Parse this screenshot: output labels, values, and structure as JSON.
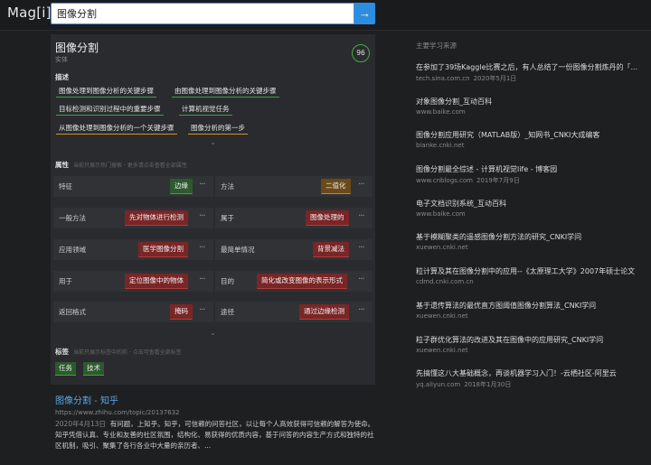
{
  "app": {
    "logo": "Mag[i]"
  },
  "search": {
    "value": "图像分割",
    "button_icon": "→"
  },
  "entity": {
    "title": "图像分割",
    "type": "实体",
    "score": "96"
  },
  "description": {
    "label": "描述",
    "tags": [
      {
        "text": "图像处理到图像分析的关键步骤",
        "color": "green"
      },
      {
        "text": "由图像处理到图像分析的关键步骤",
        "color": "green"
      },
      {
        "text": "目标检测和识别过程中的重要步骤",
        "color": "green"
      },
      {
        "text": "计算机视觉任务",
        "color": "green"
      },
      {
        "text": "从图像处理到图像分析的一个关键步骤",
        "color": "orange"
      },
      {
        "text": "图像分析的第一步",
        "color": "orange"
      }
    ],
    "expand_icon": "⌄"
  },
  "properties": {
    "label": "属性",
    "hint": "当前只展示热门搜索 · 更多请点击查看全部属性",
    "more_icon": "···",
    "rows": [
      {
        "key": "特征",
        "value": "边缘",
        "color": "green"
      },
      {
        "key": "方法",
        "value": "二值化",
        "color": "orange"
      },
      {
        "key": "一般方法",
        "value": "先对物体进行检测",
        "color": "red"
      },
      {
        "key": "属于",
        "value": "图像处理的",
        "color": "red"
      },
      {
        "key": "应用领域",
        "value": "医学图像分割",
        "color": "red"
      },
      {
        "key": "最简单情况",
        "value": "背景减法",
        "color": "red"
      },
      {
        "key": "用于",
        "value": "定位图像中的物体",
        "color": "red"
      },
      {
        "key": "目的",
        "value": "简化或改变图像的表示形式",
        "color": "red"
      },
      {
        "key": "返回格式",
        "value": "掩码",
        "color": "red"
      },
      {
        "key": "途径",
        "value": "通过边缘检测",
        "color": "red"
      }
    ],
    "expand_icon": "⌄"
  },
  "tags_section": {
    "label": "标签",
    "hint": "当前只展示标签中的前 · 点击可查看全部标签",
    "tags": [
      "任务",
      "技术"
    ]
  },
  "result": {
    "title": "图像分割 - 知乎",
    "url": "https://www.zhihu.com/topic/20137632",
    "date": "2020年4月13日",
    "snippet": "有问题，上知乎。知乎，可信赖的问答社区，以让每个人高效获得可信赖的解答为使命。知乎凭借认真、专业和友善的社区氛围，结构化、易获得的优质内容，基于问答的内容生产方式和独特的社区机制，吸引、聚集了各行各业中大量的亲历者、..."
  },
  "sources": {
    "title": "主要学习来源",
    "items": [
      {
        "title": "在参加了39场Kaggle比赛之后，有人总结了一份图像分割炼丹的「...",
        "domain": "tech.sina.com.cn",
        "date": "2020年5月1日"
      },
      {
        "title": "对象图像分割_互动百科",
        "domain": "www.baike.com",
        "date": ""
      },
      {
        "title": "图像分割应用研究（MATLAB版）_知网书_CNKI大成编客",
        "domain": "bianke.cnki.net",
        "date": ""
      },
      {
        "title": "图像分割最全综述 - 计算机视觉life - 博客园",
        "domain": "www.cnblogs.com",
        "date": "2019年7月9日"
      },
      {
        "title": "电子文档识别系统_互动百科",
        "domain": "www.baike.com",
        "date": ""
      },
      {
        "title": "基于模糊聚类的遥感图像分割方法的研究_CNKI学问",
        "domain": "xuewen.cnki.net",
        "date": ""
      },
      {
        "title": "粒计算及其在图像分割中的应用--《太原理工大学》2007年硕士论文",
        "domain": "cdmd.cnki.com.cn",
        "date": ""
      },
      {
        "title": "基于遗传算法的最优直方图阈值图像分割算法_CNKI学问",
        "domain": "xuewen.cnki.net",
        "date": ""
      },
      {
        "title": "粒子群优化算法的改进及其在图像中的应用研究_CNKI学问",
        "domain": "xuewen.cnki.net",
        "date": ""
      },
      {
        "title": "先搞懂这八大基础概念，再谈机器学习入门！-云栖社区-阿里云",
        "domain": "yq.aliyun.com",
        "date": "2018年1月30日"
      }
    ]
  }
}
